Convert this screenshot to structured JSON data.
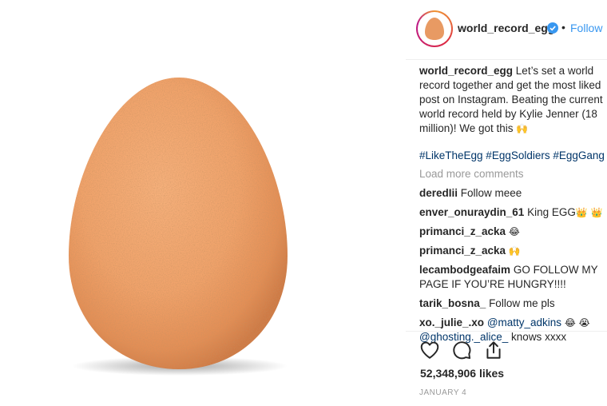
{
  "post": {
    "image_subject": "egg",
    "colors": {
      "egg": "#F0A26A",
      "link": "#3897f0",
      "hashtag": "#003569",
      "muted": "#999999"
    }
  },
  "header": {
    "username": "world_record_egg",
    "separator": "•",
    "follow_label": "Follow"
  },
  "caption": {
    "username": "world_record_egg",
    "text": "Let’s set a world record together and get the most liked post on Instagram. Beating the current world record held by Kylie Jenner (18 million)! We got this",
    "emoji": "🙌",
    "hashtags": "#LikeTheEgg #EggSoldiers #EggGang"
  },
  "load_more": "Load more comments",
  "comments": [
    {
      "username": "deredIii",
      "text": "Follow meee",
      "emoji": ""
    },
    {
      "username": "enver_onuraydin_61",
      "text": "King EGG",
      "emoji": "👑 👑"
    },
    {
      "username": "primanci_z_acka",
      "text": "",
      "emoji": "😂"
    },
    {
      "username": "primanci_z_acka",
      "text": "",
      "emoji": "🙌"
    },
    {
      "username": "lecambodgeafaim",
      "text": "GO FOLLOW MY PAGE IF YOU’RE HUNGRY!!!!",
      "emoji": ""
    },
    {
      "username": "tarik_bosna_",
      "text": "Follow me pls",
      "emoji": ""
    },
    {
      "username": "xo._julie_.xo",
      "mention": "@matty_adkins",
      "emoji": "😂 😭",
      "mention2": "@ghosting._alice_",
      "text2": "knows xxxx"
    }
  ],
  "actions": {
    "icons": [
      "heart-icon",
      "comment-icon",
      "share-icon"
    ],
    "likes": "52,348,906 likes",
    "date": "JANUARY 4"
  }
}
